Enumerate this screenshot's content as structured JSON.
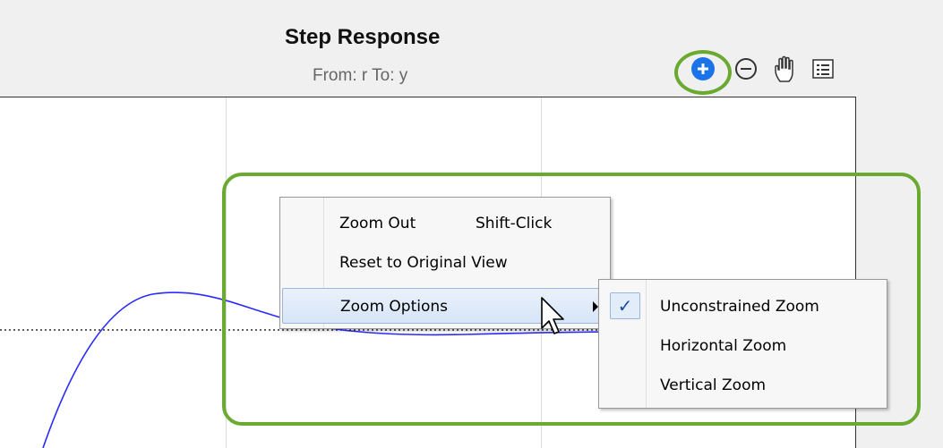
{
  "plot": {
    "title": "Step Response",
    "subtitle": "From: r  To: y"
  },
  "toolbar": {
    "icons": [
      "zoom-in-icon",
      "zoom-out-icon",
      "pan-icon",
      "data-cursor-icon"
    ],
    "active_tool": "zoom-in"
  },
  "context_menu": {
    "items": [
      {
        "label": "Zoom Out",
        "shortcut": "Shift-Click"
      },
      {
        "label": "Reset to Original View"
      },
      {
        "label": "Zoom Options",
        "has_submenu": true
      }
    ],
    "submenu": [
      {
        "label": "Unconstrained Zoom",
        "checked": true,
        "check_glyph": "✓"
      },
      {
        "label": "Horizontal Zoom",
        "checked": false
      },
      {
        "label": "Vertical Zoom",
        "checked": false
      }
    ]
  },
  "colors": {
    "highlight": "#6aaa30",
    "response_line": "#1f1fff",
    "active_tool": "#1a73e8"
  }
}
